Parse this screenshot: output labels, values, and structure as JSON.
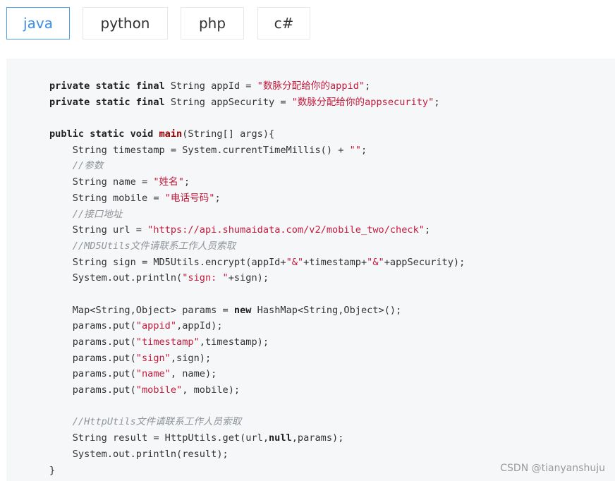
{
  "tabs": [
    {
      "label": "java",
      "active": true
    },
    {
      "label": "python",
      "active": false
    },
    {
      "label": "php",
      "active": false
    },
    {
      "label": "c#",
      "active": false
    }
  ],
  "code": {
    "lines": [
      [
        {
          "t": "private static final ",
          "c": "kw"
        },
        {
          "t": "String appId = ",
          "c": "plain"
        },
        {
          "t": "\"数脉分配给你的appid\"",
          "c": "str"
        },
        {
          "t": ";",
          "c": "plain"
        }
      ],
      [
        {
          "t": "private static final ",
          "c": "kw"
        },
        {
          "t": "String appSecurity = ",
          "c": "plain"
        },
        {
          "t": "\"数脉分配给你的appsecurity\"",
          "c": "str"
        },
        {
          "t": ";",
          "c": "plain"
        }
      ],
      [],
      [
        {
          "t": "public static void ",
          "c": "kw"
        },
        {
          "t": "main",
          "c": "fn"
        },
        {
          "t": "(String[] args){",
          "c": "plain"
        }
      ],
      [
        {
          "t": "    String timestamp = System.currentTimeMillis() + ",
          "c": "plain"
        },
        {
          "t": "\"\"",
          "c": "str"
        },
        {
          "t": ";",
          "c": "plain"
        }
      ],
      [
        {
          "t": "    //参数",
          "c": "cmt"
        }
      ],
      [
        {
          "t": "    String name = ",
          "c": "plain"
        },
        {
          "t": "\"姓名\"",
          "c": "str"
        },
        {
          "t": ";",
          "c": "plain"
        }
      ],
      [
        {
          "t": "    String mobile = ",
          "c": "plain"
        },
        {
          "t": "\"电话号码\"",
          "c": "str"
        },
        {
          "t": ";",
          "c": "plain"
        }
      ],
      [
        {
          "t": "    //接口地址",
          "c": "cmt"
        }
      ],
      [
        {
          "t": "    String url = ",
          "c": "plain"
        },
        {
          "t": "\"https://api.shumaidata.com/v2/mobile_two/check\"",
          "c": "str"
        },
        {
          "t": ";",
          "c": "plain"
        }
      ],
      [
        {
          "t": "    //MD5Utils文件请联系工作人员索取",
          "c": "cmt"
        }
      ],
      [
        {
          "t": "    String sign = MD5Utils.encrypt(appId+",
          "c": "plain"
        },
        {
          "t": "\"&\"",
          "c": "str"
        },
        {
          "t": "+timestamp+",
          "c": "plain"
        },
        {
          "t": "\"&\"",
          "c": "str"
        },
        {
          "t": "+appSecurity);",
          "c": "plain"
        }
      ],
      [
        {
          "t": "    System.out.println(",
          "c": "plain"
        },
        {
          "t": "\"sign: \"",
          "c": "str"
        },
        {
          "t": "+sign);",
          "c": "plain"
        }
      ],
      [],
      [
        {
          "t": "    Map<String,Object> params = ",
          "c": "plain"
        },
        {
          "t": "new ",
          "c": "kw"
        },
        {
          "t": "HashMap<String,Object>();",
          "c": "plain"
        }
      ],
      [
        {
          "t": "    params.put(",
          "c": "plain"
        },
        {
          "t": "\"appid\"",
          "c": "str"
        },
        {
          "t": ",appId);",
          "c": "plain"
        }
      ],
      [
        {
          "t": "    params.put(",
          "c": "plain"
        },
        {
          "t": "\"timestamp\"",
          "c": "str"
        },
        {
          "t": ",timestamp);",
          "c": "plain"
        }
      ],
      [
        {
          "t": "    params.put(",
          "c": "plain"
        },
        {
          "t": "\"sign\"",
          "c": "str"
        },
        {
          "t": ",sign);",
          "c": "plain"
        }
      ],
      [
        {
          "t": "    params.put(",
          "c": "plain"
        },
        {
          "t": "\"name\"",
          "c": "str"
        },
        {
          "t": ", name);",
          "c": "plain"
        }
      ],
      [
        {
          "t": "    params.put(",
          "c": "plain"
        },
        {
          "t": "\"mobile\"",
          "c": "str"
        },
        {
          "t": ", mobile);",
          "c": "plain"
        }
      ],
      [],
      [
        {
          "t": "    //HttpUtils文件请联系工作人员索取",
          "c": "cmt"
        }
      ],
      [
        {
          "t": "    String result = HttpUtils.get(url,",
          "c": "plain"
        },
        {
          "t": "null",
          "c": "kw"
        },
        {
          "t": ",params);",
          "c": "plain"
        }
      ],
      [
        {
          "t": "    System.out.println(result);",
          "c": "plain"
        }
      ],
      [
        {
          "t": "}",
          "c": "plain"
        }
      ]
    ]
  },
  "watermark": "CSDN @tianyanshuju",
  "colors": {
    "active_tab": "#3a8ee6",
    "string": "#c41a3c",
    "comment": "#8f9499",
    "code_bg": "#f6f7f9"
  }
}
